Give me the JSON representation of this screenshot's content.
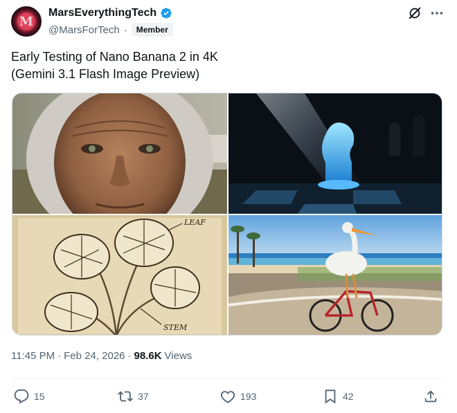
{
  "author": {
    "display_name": "MarsEverythingTech",
    "handle": "@MarsForTech",
    "separator": "·",
    "badge": "Member",
    "avatar_letter": "M",
    "verified_color": "#1d9bf0"
  },
  "header_icons": [
    "grok-icon",
    "more-options-icon"
  ],
  "tweet": {
    "lines": [
      "Early Testing of Nano Banana 2 in 4K",
      "(Gemini 3.1 Flash Image Preview)"
    ]
  },
  "media": {
    "images": [
      {
        "name": "portrait-elderly-woman"
      },
      {
        "name": "glass-chess-knight"
      },
      {
        "name": "monstera-botanical-sketch",
        "labels": [
          "LEAF",
          "STEM"
        ]
      },
      {
        "name": "pelican-riding-bicycle"
      }
    ]
  },
  "meta": {
    "time": "11:45 PM",
    "sep1": "·",
    "date": "Feb 24, 2026",
    "sep2": "·",
    "views_count": "98.6K",
    "views_label": "Views"
  },
  "actions": {
    "replies": "15",
    "reposts": "37",
    "likes": "193",
    "bookmarks": "42"
  },
  "colors": {
    "text_primary": "#0f1419",
    "text_secondary": "#536471",
    "border": "#cfd9de"
  }
}
